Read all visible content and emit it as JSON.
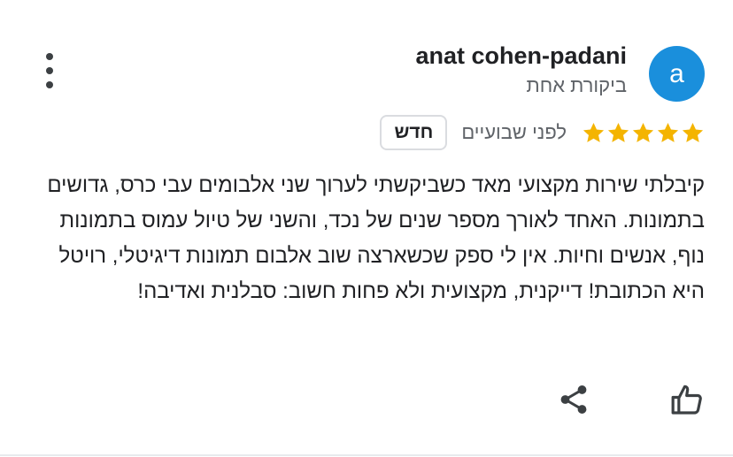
{
  "review": {
    "author": {
      "avatar_letter": "a",
      "avatar_color": "#1a8fdc",
      "name": "anat cohen-padani",
      "subtitle": "ביקורת אחת"
    },
    "menu_icon": "more-vertical-icon",
    "rating": {
      "stars": 5,
      "max_stars": 5,
      "star_color": "#f4b400",
      "time_ago": "לפני שבועיים",
      "badge": "חדש"
    },
    "text": "קיבלתי שירות מקצועי מאד כשביקשתי לערוך שני אלבומים עבי כרס, גדושים בתמונות. האחד לאורך מספר שנים של נכד, והשני של טיול עמוס בתמונות נוף, אנשים וחיות. אין לי ספק שכשארצה שוב אלבום תמונות דיגיטלי, רויטל היא הכתובת! דייקנית, מקצועית ולא פחות חשוב: סבלנית ואדיבה!",
    "actions": {
      "like_icon": "thumbs-up-icon",
      "share_icon": "share-icon"
    }
  }
}
